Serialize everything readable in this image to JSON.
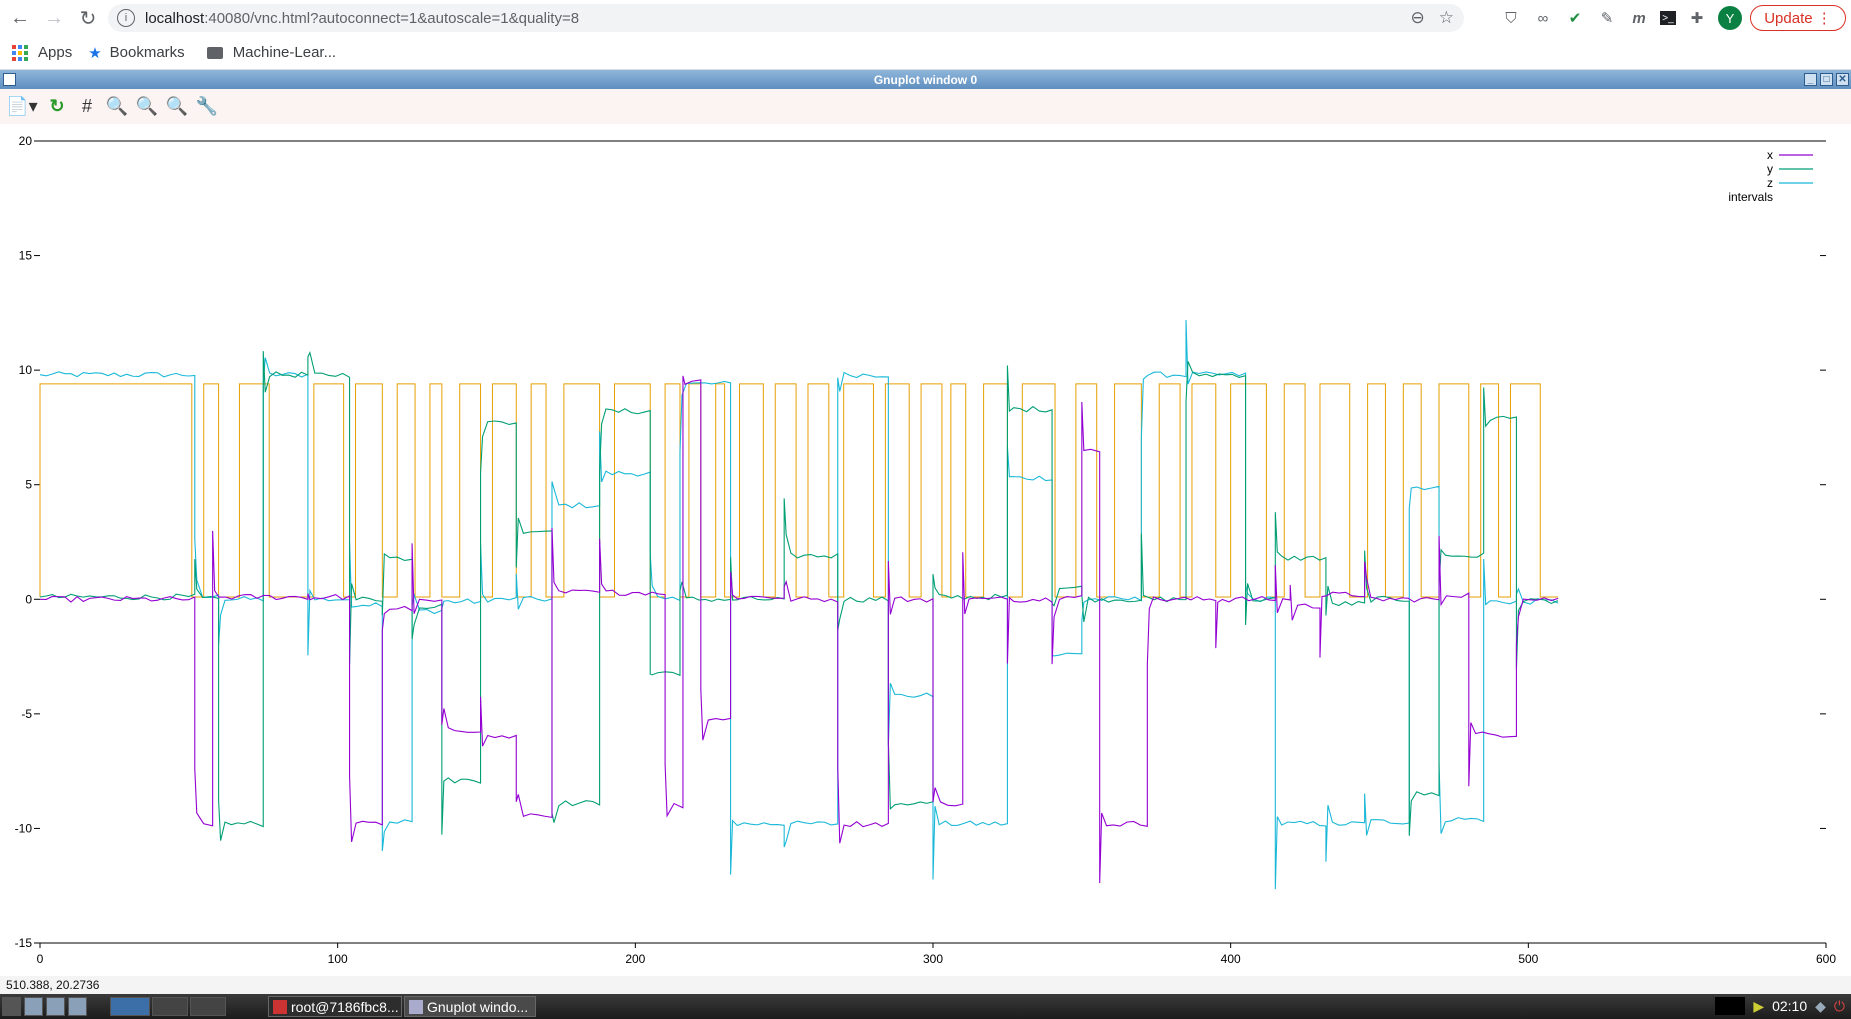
{
  "browser": {
    "url_host": "localhost",
    "url_rest": ":40080/vnc.html?autoconnect=1&autoscale=1&quality=8",
    "update_label": "Update",
    "avatar_letter": "Y"
  },
  "bookmarks": {
    "apps": "Apps",
    "bookmarks": "Bookmarks",
    "folder": "Machine-Lear..."
  },
  "gnuplot": {
    "title": "Gnuplot window 0",
    "status": "510.388,  20.2736"
  },
  "taskbar": {
    "task1": "root@7186fbc8...",
    "task2": "Gnuplot windo...",
    "clock": "02:10"
  },
  "chart_data": {
    "type": "line",
    "xlim": [
      0,
      600
    ],
    "ylim": [
      -15,
      20
    ],
    "x_ticks": [
      0,
      100,
      200,
      300,
      400,
      500,
      600
    ],
    "y_ticks": [
      -15,
      -10,
      -5,
      0,
      5,
      10,
      15,
      20
    ],
    "y_tick_labels": [
      "-15",
      "-10",
      "-5",
      "0",
      "5",
      "10",
      "15",
      "20"
    ],
    "legend_position": "top-right",
    "grid": false,
    "series": [
      {
        "name": "x",
        "color": "#9400d3"
      },
      {
        "name": "y",
        "color": "#009e73"
      },
      {
        "name": "z",
        "color": "#1ab8d8"
      },
      {
        "name": "intervals",
        "color": "#e69f00"
      }
    ],
    "intervals_on": [
      [
        0,
        51
      ],
      [
        55,
        60
      ],
      [
        67,
        77
      ],
      [
        92,
        102
      ],
      [
        106,
        115
      ],
      [
        120,
        126
      ],
      [
        131,
        135
      ],
      [
        141,
        148
      ],
      [
        152,
        160
      ],
      [
        165,
        170
      ],
      [
        176,
        188
      ],
      [
        193,
        205
      ],
      [
        210,
        215
      ],
      [
        218,
        222
      ],
      [
        227,
        230
      ],
      [
        235,
        243
      ],
      [
        247,
        254
      ],
      [
        258,
        265
      ],
      [
        270,
        280
      ],
      [
        284,
        292
      ],
      [
        296,
        303
      ],
      [
        306,
        311
      ],
      [
        317,
        325
      ],
      [
        330,
        341
      ],
      [
        348,
        355
      ],
      [
        361,
        370
      ],
      [
        376,
        383
      ],
      [
        387,
        395
      ],
      [
        400,
        412
      ],
      [
        418,
        425
      ],
      [
        430,
        440
      ],
      [
        446,
        452
      ],
      [
        458,
        464
      ],
      [
        470,
        480
      ],
      [
        484,
        490
      ],
      [
        494,
        504
      ]
    ],
    "x_levels": [
      [
        0,
        52,
        0
      ],
      [
        52,
        58,
        -9.8
      ],
      [
        58,
        90,
        0.1
      ],
      [
        90,
        104,
        0.1
      ],
      [
        104,
        115,
        -9.8
      ],
      [
        115,
        125,
        -0.4
      ],
      [
        125,
        135,
        -0.1
      ],
      [
        135,
        148,
        -5.7
      ],
      [
        148,
        160,
        -6
      ],
      [
        160,
        172,
        -9.4
      ],
      [
        172,
        188,
        0.3
      ],
      [
        188,
        210,
        0.3
      ],
      [
        210,
        216,
        -9
      ],
      [
        216,
        222,
        9.6
      ],
      [
        222,
        232,
        -5.2
      ],
      [
        232,
        250,
        0.1
      ],
      [
        250,
        268,
        0
      ],
      [
        268,
        285,
        -9.8
      ],
      [
        285,
        300,
        0
      ],
      [
        300,
        310,
        -8.9
      ],
      [
        310,
        325,
        0
      ],
      [
        325,
        340,
        0
      ],
      [
        340,
        350,
        0.1
      ],
      [
        350,
        356,
        6.5
      ],
      [
        356,
        372,
        -9.8
      ],
      [
        372,
        395,
        0
      ],
      [
        395,
        415,
        0
      ],
      [
        415,
        420,
        0
      ],
      [
        420,
        430,
        -0.3
      ],
      [
        430,
        445,
        0.2
      ],
      [
        445,
        470,
        0
      ],
      [
        470,
        480,
        0.2
      ],
      [
        480,
        496,
        -5.9
      ],
      [
        496,
        510,
        0
      ]
    ],
    "y_levels": [
      [
        0,
        52,
        0.1
      ],
      [
        52,
        60,
        0
      ],
      [
        60,
        75,
        -9.8
      ],
      [
        75,
        90,
        9.8
      ],
      [
        90,
        104,
        9.8
      ],
      [
        104,
        115,
        0
      ],
      [
        115,
        125,
        1.8
      ],
      [
        125,
        135,
        -0.3
      ],
      [
        135,
        148,
        -7.9
      ],
      [
        148,
        160,
        7.7
      ],
      [
        160,
        172,
        3
      ],
      [
        172,
        188,
        -8.9
      ],
      [
        188,
        205,
        8.2
      ],
      [
        205,
        215,
        -3.2
      ],
      [
        215,
        232,
        0
      ],
      [
        232,
        250,
        0
      ],
      [
        250,
        268,
        1.9
      ],
      [
        268,
        285,
        0
      ],
      [
        285,
        300,
        -8.9
      ],
      [
        300,
        325,
        0.1
      ],
      [
        325,
        340,
        8.3
      ],
      [
        340,
        350,
        0.5
      ],
      [
        350,
        370,
        0
      ],
      [
        370,
        385,
        0
      ],
      [
        385,
        405,
        9.8
      ],
      [
        405,
        415,
        0
      ],
      [
        415,
        432,
        1.8
      ],
      [
        432,
        445,
        -0.2
      ],
      [
        445,
        460,
        0
      ],
      [
        460,
        470,
        -8.5
      ],
      [
        470,
        485,
        1.9
      ],
      [
        485,
        496,
        7.9
      ],
      [
        496,
        510,
        -0.1
      ]
    ],
    "z_levels": [
      [
        0,
        52,
        9.8
      ],
      [
        52,
        60,
        0.1
      ],
      [
        60,
        75,
        0
      ],
      [
        75,
        90,
        9.8
      ],
      [
        90,
        104,
        0
      ],
      [
        104,
        115,
        -0.2
      ],
      [
        115,
        125,
        -9.7
      ],
      [
        125,
        135,
        -0.5
      ],
      [
        135,
        148,
        -0.1
      ],
      [
        148,
        160,
        0
      ],
      [
        160,
        172,
        0
      ],
      [
        172,
        188,
        4.1
      ],
      [
        188,
        205,
        5.5
      ],
      [
        205,
        215,
        0
      ],
      [
        215,
        232,
        9.4
      ],
      [
        232,
        250,
        -9.8
      ],
      [
        250,
        268,
        -9.8
      ],
      [
        268,
        285,
        9.8
      ],
      [
        285,
        300,
        -4.2
      ],
      [
        300,
        325,
        -9.8
      ],
      [
        325,
        340,
        5.3
      ],
      [
        340,
        350,
        -2.4
      ],
      [
        350,
        370,
        0
      ],
      [
        370,
        385,
        9.8
      ],
      [
        385,
        405,
        9.8
      ],
      [
        405,
        415,
        0
      ],
      [
        415,
        432,
        -9.8
      ],
      [
        432,
        445,
        -9.8
      ],
      [
        445,
        460,
        -9.7
      ],
      [
        460,
        470,
        4.9
      ],
      [
        470,
        485,
        -9.6
      ],
      [
        485,
        496,
        -0.1
      ],
      [
        496,
        510,
        -0.1
      ]
    ]
  }
}
